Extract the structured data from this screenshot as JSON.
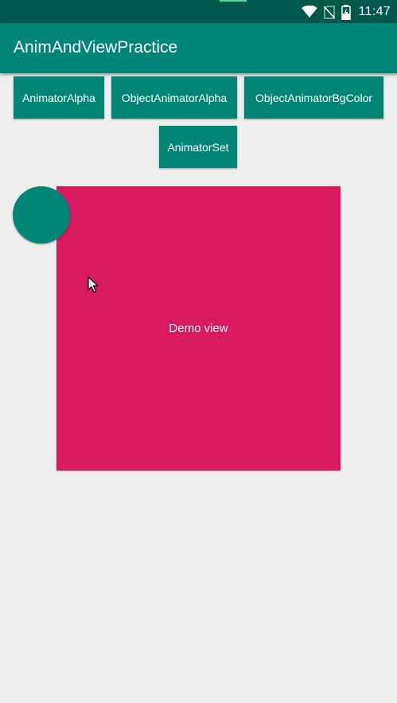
{
  "status_bar": {
    "time": "11:47",
    "icons": [
      "wifi-icon",
      "no-sim-icon",
      "battery-charging-icon"
    ]
  },
  "app_bar": {
    "title": "AnimAndViewPractice"
  },
  "buttons": {
    "animator_alpha": "AnimatorAlpha",
    "object_animator_alpha": "ObjectAnimatorAlpha",
    "object_animator_bg_color": "ObjectAnimatorBgColor",
    "animator_set": "AnimatorSet"
  },
  "demo_view": {
    "label": "Demo view"
  },
  "colors": {
    "primary": "#008577",
    "primary_dark": "#00574b",
    "accent": "#d81b60",
    "background": "#eeeeee"
  }
}
